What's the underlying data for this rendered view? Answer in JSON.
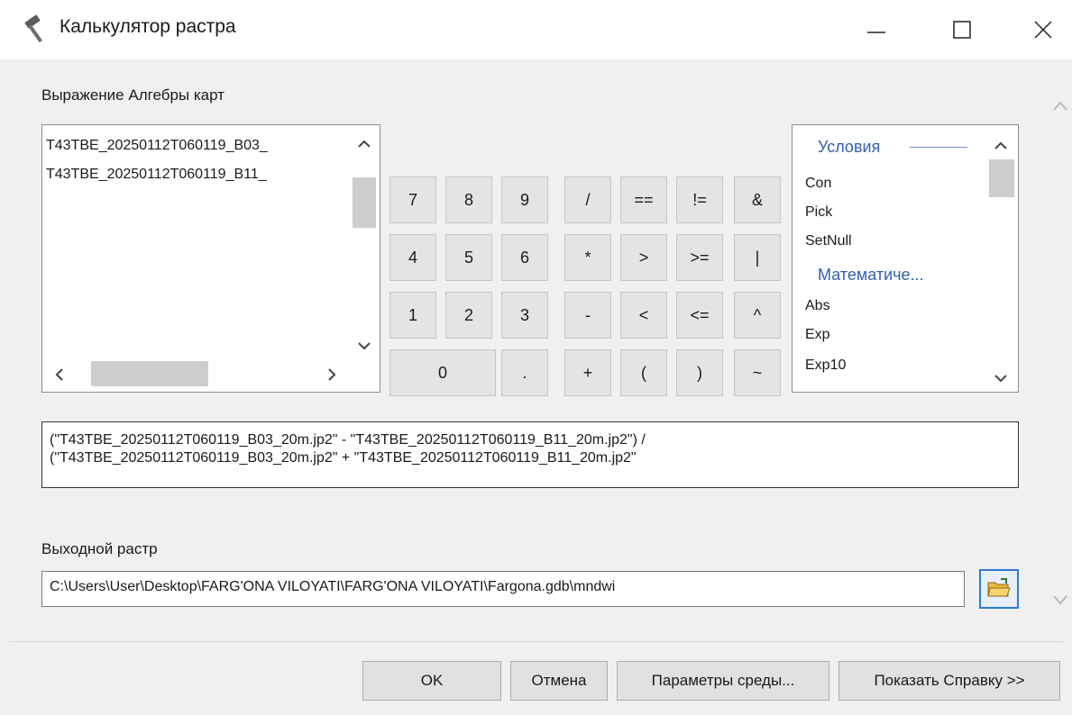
{
  "window": {
    "title": "Калькулятор растра",
    "colors": {
      "titlebar": "#ffffff",
      "body": "#f0f0f0",
      "accent": "#2d7bd6",
      "category": "#3060b0"
    }
  },
  "expression_label": "Выражение Алгебры карт",
  "layers": [
    "T43TBE_20250112T060119_B03_",
    "T43TBE_20250112T060119_B11_"
  ],
  "keypad": [
    "7",
    "8",
    "9",
    "/",
    "==",
    "!=",
    "&",
    "4",
    "5",
    "6",
    "*",
    ">",
    ">=",
    "|",
    "1",
    "2",
    "3",
    "-",
    "<",
    "<=",
    "^",
    "0",
    ".",
    "+",
    "(",
    ")",
    "~"
  ],
  "functions": {
    "cat1": "Условия",
    "items1": [
      "Con",
      "Pick",
      "SetNull"
    ],
    "cat2": "Математиче...",
    "items2": [
      "Abs",
      "Exp",
      "Exp10"
    ]
  },
  "expression": {
    "line1": "(\"T43TBE_20250112T060119_B03_20m.jp2\" - \"T43TBE_20250112T060119_B11_20m.jp2\") /",
    "line2": "(\"T43TBE_20250112T060119_B03_20m.jp2\" + \"T43TBE_20250112T060119_B11_20m.jp2\""
  },
  "output": {
    "label": "Выходной растр",
    "path": "C:\\Users\\User\\Desktop\\FARG'ONA VILOYATI\\FARG'ONA VILOYATI\\Fargona.gdb\\mndwi"
  },
  "buttons": {
    "ok": "OK",
    "cancel": "Отмена",
    "env": "Параметры среды...",
    "help": "Показать Справку >>"
  },
  "icons": [
    "hammer-icon",
    "minimize-icon",
    "maximize-icon",
    "close-icon",
    "folder-open-icon",
    "chevron-up-icon",
    "chevron-down-icon",
    "chevron-left-icon",
    "chevron-right-icon"
  ]
}
